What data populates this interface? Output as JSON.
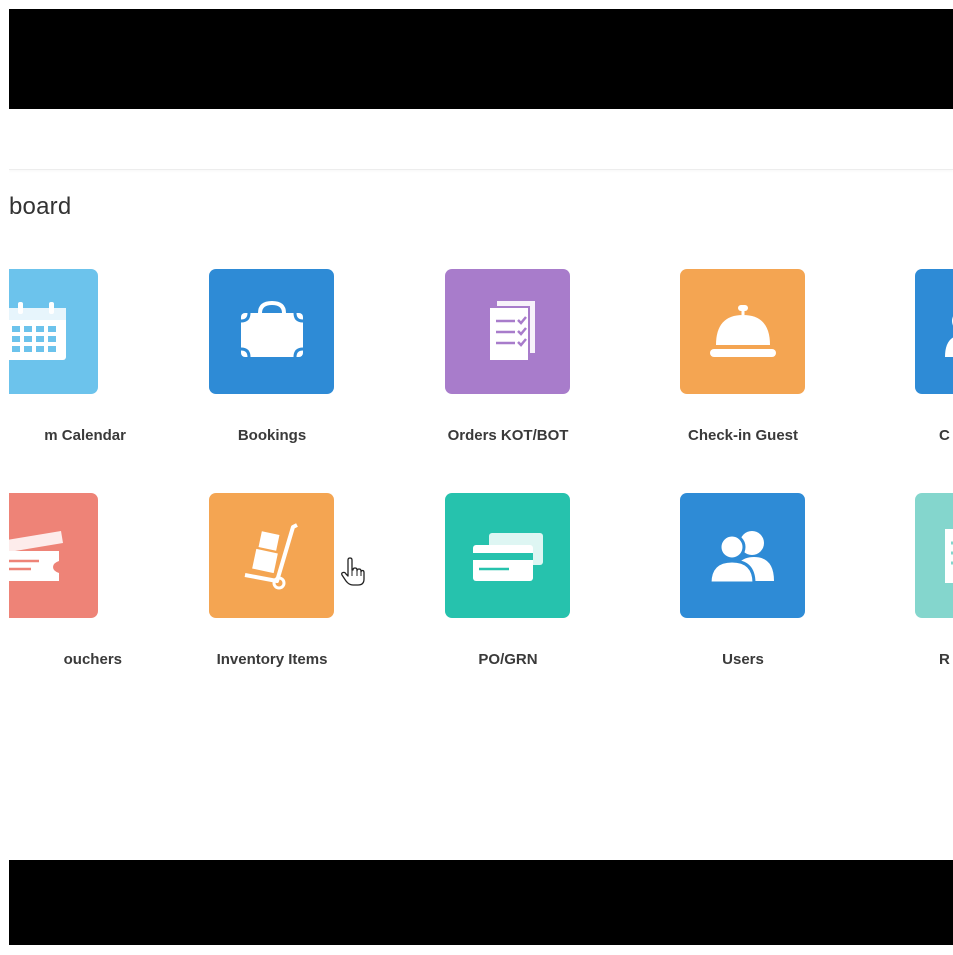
{
  "page": {
    "title": "board"
  },
  "tiles_row1": [
    {
      "label": "m Calendar",
      "icon": "calendar-icon",
      "color": "#6cc3ec"
    },
    {
      "label": "Bookings",
      "icon": "suitcase-icon",
      "color": "#2e8bd6"
    },
    {
      "label": "Orders KOT/BOT",
      "icon": "orders-icon",
      "color": "#a87ccb"
    },
    {
      "label": "Check-in Guest",
      "icon": "service-bell-icon",
      "color": "#f4a552"
    },
    {
      "label": "C",
      "icon": "guest-icon",
      "color": "#2e8bd6"
    }
  ],
  "tiles_row2": [
    {
      "label": "ouchers",
      "icon": "voucher-icon",
      "color": "#ee8377"
    },
    {
      "label": "Inventory Items",
      "icon": "hand-truck-icon",
      "color": "#f4a552"
    },
    {
      "label": "PO/GRN",
      "icon": "cards-icon",
      "color": "#26c2ad"
    },
    {
      "label": "Users",
      "icon": "users-icon",
      "color": "#2e8bd6"
    },
    {
      "label": "R",
      "icon": "report-icon",
      "color": "#84d6cd"
    }
  ]
}
